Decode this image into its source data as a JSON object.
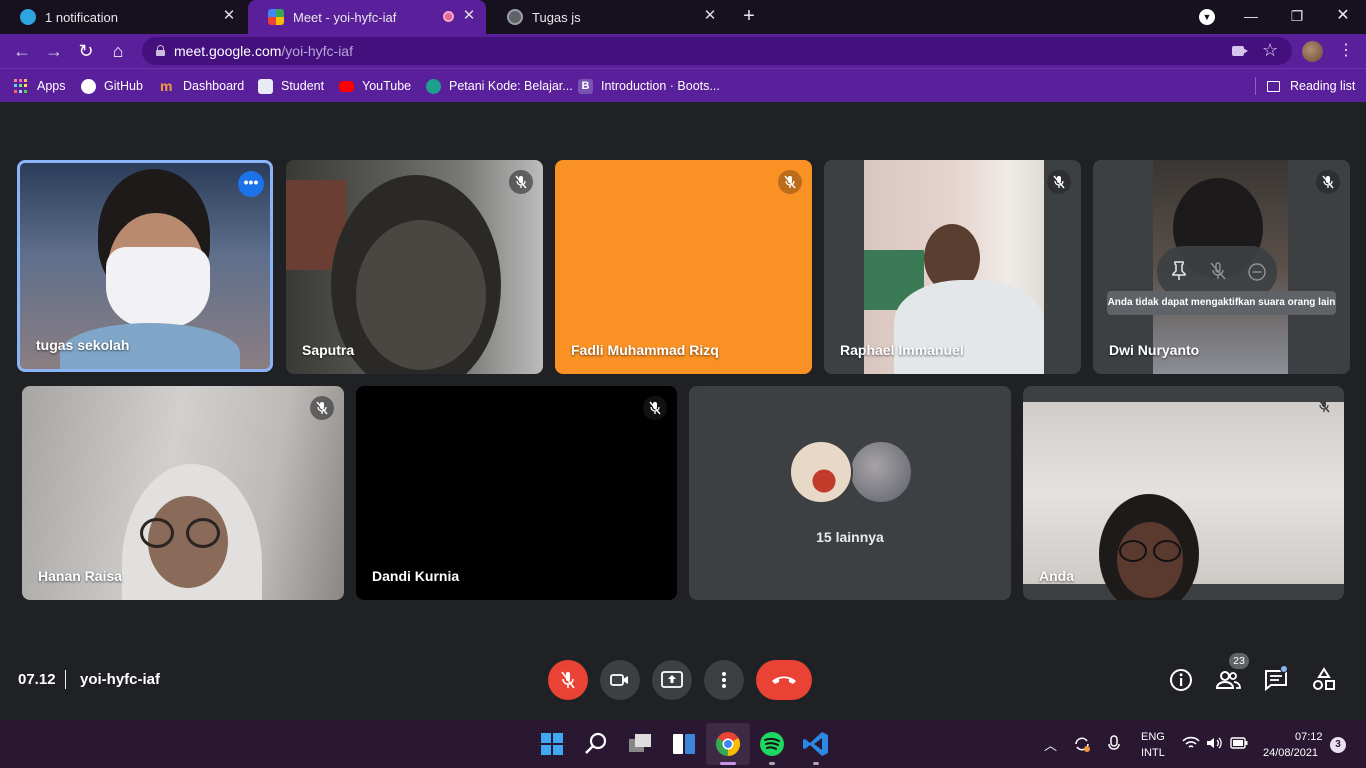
{
  "tabs": [
    {
      "title": "1 notification",
      "icon": "telegram-icon"
    },
    {
      "title": "Meet - yoi-hyfc-iaf",
      "icon": "google-meet-icon",
      "active": true
    },
    {
      "title": "Tugas js",
      "icon": "globe-icon"
    }
  ],
  "address_bar": {
    "host": "meet.google.com",
    "path": "/yoi-hyfc-iaf"
  },
  "bookmarks": [
    {
      "label": "Apps"
    },
    {
      "label": "GitHub"
    },
    {
      "label": "Dashboard"
    },
    {
      "label": "Student"
    },
    {
      "label": "YouTube"
    },
    {
      "label": "Petani Kode: Belajar..."
    },
    {
      "label": "Introduction · Boots..."
    }
  ],
  "reading_list": "Reading list",
  "participants": [
    {
      "name": "tugas sekolah",
      "muted": false,
      "highlighted": true
    },
    {
      "name": "Saputra",
      "muted": true
    },
    {
      "name": "Fadli Muhammad Rizq",
      "muted": true,
      "tile_color": "#fa9124"
    },
    {
      "name": "Raphael Immanuel",
      "muted": true
    },
    {
      "name": "Dwi Nuryanto",
      "muted": true
    },
    {
      "name": "Hanan Raisa",
      "muted": true
    },
    {
      "name": "Dandi Kurnia",
      "muted": true
    },
    {
      "name": "Anda",
      "muted": true
    }
  ],
  "others_tile": {
    "label": "15 lainnya"
  },
  "hover_tooltip": "Anda tidak dapat mengaktifkan suara orang lain",
  "meeting": {
    "time": "07.12",
    "code": "yoi-hyfc-iaf",
    "people_count": "23"
  },
  "colors": {
    "end_call": "#ea4335",
    "browser_theme": "#5a1f9a",
    "meet_bg": "#202124",
    "accent_blue": "#8ab4f8"
  },
  "taskbar": {
    "language": "ENG",
    "layout": "INTL",
    "time": "07:12",
    "date": "24/08/2021",
    "notifications": "3"
  }
}
